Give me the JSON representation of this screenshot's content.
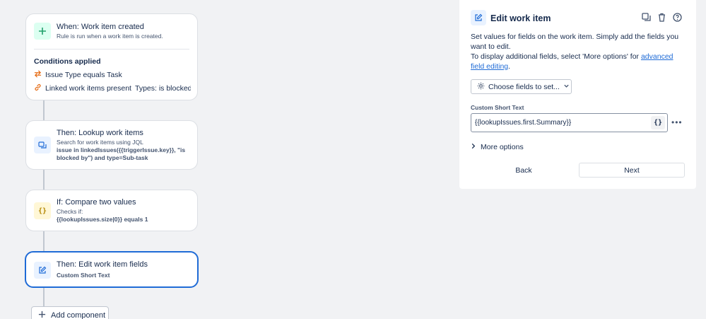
{
  "flow": {
    "trigger": {
      "title": "When: Work item created",
      "subtitle": "Rule is run when a work item is created."
    },
    "conditions": {
      "heading": "Conditions applied",
      "items": [
        {
          "icon": "swap-arrows-icon",
          "text": "Issue Type equals Task"
        },
        {
          "icon": "link-icon",
          "text_bold": "Linked work items present",
          "text": "Types: is blocked by"
        }
      ]
    },
    "lookup": {
      "title": "Then: Lookup work items",
      "subtitle": "Search for work items using JQL",
      "query": "issue in linkedIssues({{triggerIssue.key}}, \"is blocked by\") and type=Sub-task"
    },
    "compare": {
      "title": "If: Compare two values",
      "subtitle": "Checks if:",
      "expression": "{{lookupIssues.size|0}} equals 1"
    },
    "edit": {
      "title": "Then: Edit work item fields",
      "subtitle": "Custom Short Text"
    },
    "add_component": "Add component"
  },
  "panel": {
    "title": "Edit work item",
    "desc_line1": "Set values for fields on the work item. Simply add the fields you want to edit.",
    "desc_line2_prefix": "To display additional fields, select 'More options' for ",
    "desc_link": "advanced field editing",
    "desc_suffix": ".",
    "choose_fields": "Choose fields to set...",
    "field_label": "Custom Short Text",
    "field_value": "{{lookupIssues.first.Summary}}",
    "braces": "{}",
    "more_options": "More options",
    "back": "Back",
    "next": "Next"
  },
  "colors": {
    "accent": "#1f6bd6",
    "trigger_icon": "#22a06b",
    "condition_icon": "#e56910",
    "action_icon": "#1f6bd6",
    "branch_icon": "#b38600"
  }
}
